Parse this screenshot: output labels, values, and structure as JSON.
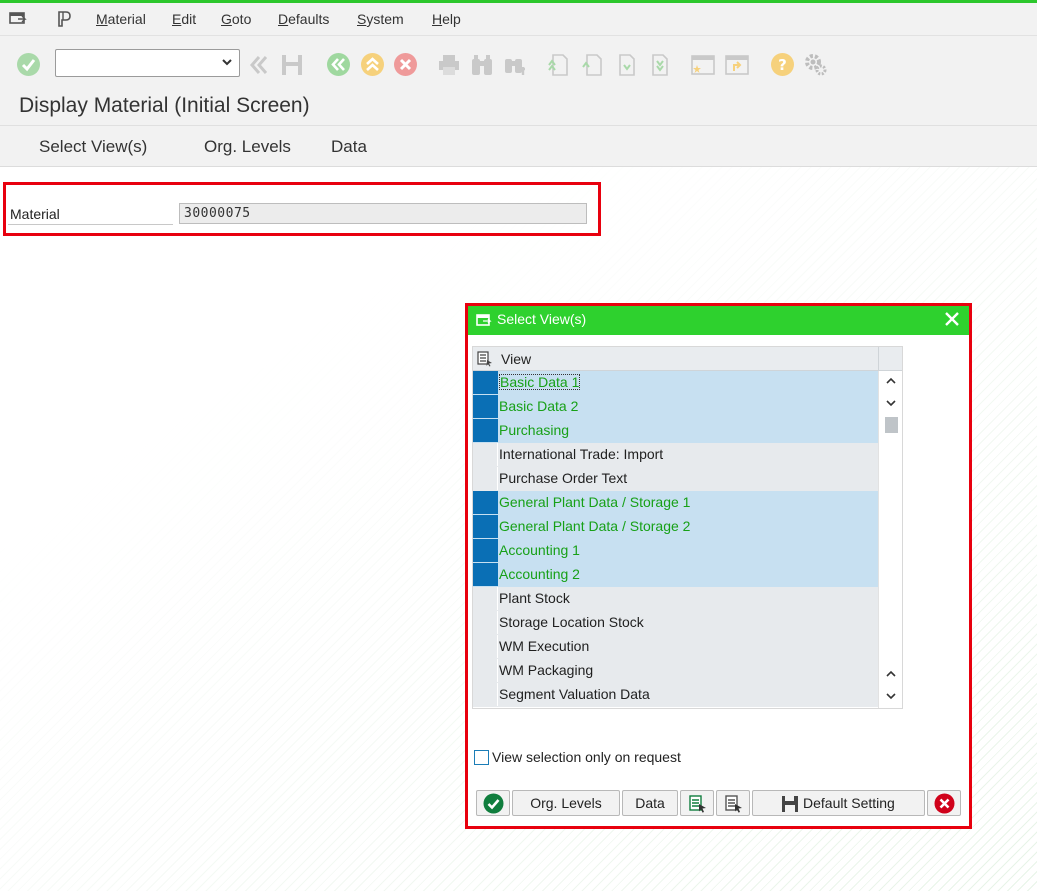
{
  "menubar": {
    "items": [
      "Material",
      "Edit",
      "Goto",
      "Defaults",
      "System",
      "Help"
    ],
    "underline_first": [
      "M",
      "E",
      "G",
      "D",
      "S",
      "H"
    ]
  },
  "toolbar": {
    "command_field_value": ""
  },
  "page": {
    "title": "Display Material (Initial Screen)"
  },
  "app_toolbar": {
    "buttons": [
      "Select View(s)",
      "Org. Levels",
      "Data"
    ]
  },
  "form": {
    "material_label": "Material",
    "material_value": "30000075"
  },
  "dialog": {
    "title": "Select View(s)",
    "column_header": "View",
    "rows": [
      {
        "label": "Basic Data 1",
        "selected": true
      },
      {
        "label": "Basic Data 2",
        "selected": true
      },
      {
        "label": "Purchasing",
        "selected": true
      },
      {
        "label": "International Trade: Import",
        "selected": false
      },
      {
        "label": "Purchase Order Text",
        "selected": false
      },
      {
        "label": "General Plant Data / Storage 1",
        "selected": true
      },
      {
        "label": "General Plant Data / Storage 2",
        "selected": true
      },
      {
        "label": "Accounting 1",
        "selected": true
      },
      {
        "label": "Accounting 2",
        "selected": true
      },
      {
        "label": "Plant Stock",
        "selected": false
      },
      {
        "label": "Storage Location Stock",
        "selected": false
      },
      {
        "label": "WM Execution",
        "selected": false
      },
      {
        "label": "WM Packaging",
        "selected": false
      },
      {
        "label": "Segment Valuation Data",
        "selected": false
      }
    ],
    "checkbox_label": "View selection only on request",
    "checkbox_checked": false,
    "buttons": {
      "org_levels": "Org. Levels",
      "data": "Data",
      "default_setting": "Default Setting"
    }
  },
  "colors": {
    "title_green": "#2ed12e",
    "highlight_red": "#e8000e",
    "selected_row_bg": "#c7e0f1",
    "selected_marker": "#0a6fb5",
    "selected_text": "#17a017"
  }
}
